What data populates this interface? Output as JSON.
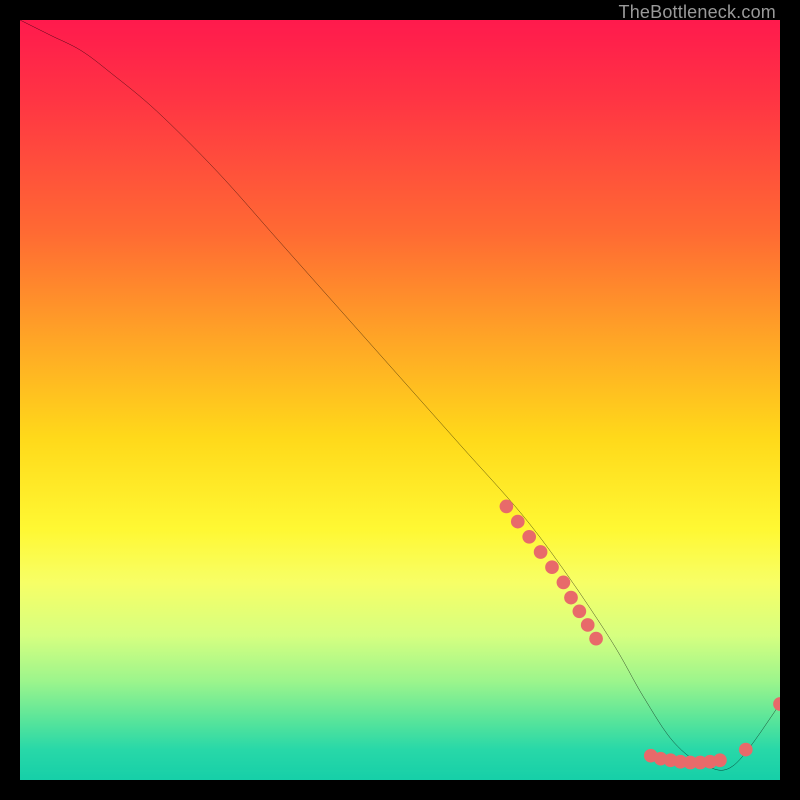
{
  "watermark": "TheBottleneck.com",
  "chart_data": {
    "type": "line",
    "title": "",
    "xlabel": "",
    "ylabel": "",
    "xlim": [
      0,
      100
    ],
    "ylim": [
      0,
      100
    ],
    "grid": false,
    "legend": false,
    "series": [
      {
        "name": "bottleneck-curve",
        "color": "#000000",
        "x": [
          0,
          4,
          8,
          12,
          18,
          26,
          34,
          42,
          50,
          58,
          66,
          72,
          78,
          82,
          86,
          90,
          94,
          100
        ],
        "y": [
          100,
          98,
          96,
          93,
          88,
          80,
          71,
          62,
          53,
          44,
          35,
          27,
          18,
          11,
          5,
          2,
          2,
          10
        ]
      }
    ],
    "marker_clusters": [
      {
        "name": "points-upper",
        "color": "#e86a6a",
        "x": [
          64,
          65.5,
          67,
          68.5,
          70,
          71.5
        ],
        "y": [
          36,
          34,
          32,
          30,
          28,
          26
        ]
      },
      {
        "name": "points-mid",
        "color": "#e86a6a",
        "x": [
          72.5,
          73.6,
          74.7,
          75.8
        ],
        "y": [
          24,
          22.2,
          20.4,
          18.6
        ]
      },
      {
        "name": "points-valley",
        "color": "#e86a6a",
        "x": [
          83,
          84.3,
          85.6,
          86.9,
          88.2,
          89.5,
          90.8,
          92.1
        ],
        "y": [
          3.2,
          2.8,
          2.6,
          2.4,
          2.3,
          2.3,
          2.4,
          2.6
        ]
      },
      {
        "name": "points-right",
        "color": "#e86a6a",
        "x": [
          95.5,
          100
        ],
        "y": [
          4.0,
          10.0
        ]
      }
    ],
    "background": {
      "type": "vertical-gradient",
      "stops": [
        {
          "pos": 0.0,
          "color": "#ff1a4d"
        },
        {
          "pos": 0.28,
          "color": "#ff6a33"
        },
        {
          "pos": 0.55,
          "color": "#ffd91a"
        },
        {
          "pos": 0.74,
          "color": "#f7ff66"
        },
        {
          "pos": 0.92,
          "color": "#5ae59a"
        },
        {
          "pos": 1.0,
          "color": "#16cfa8"
        }
      ]
    }
  }
}
